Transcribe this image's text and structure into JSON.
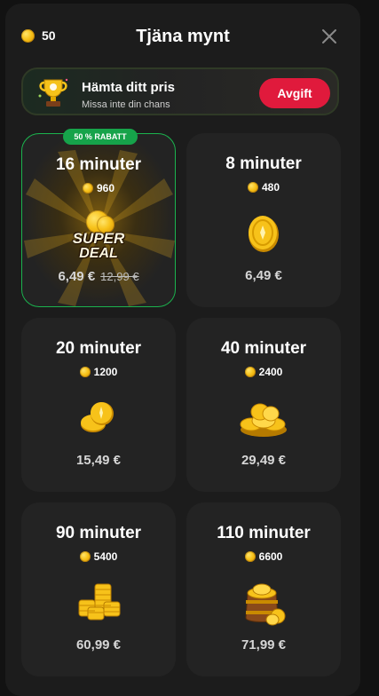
{
  "header": {
    "balance": "50",
    "title": "Tjäna mynt",
    "close_label": "close"
  },
  "banner": {
    "title": "Hämta ditt pris",
    "subtitle": "Missa inte din chans",
    "button_label": "Avgift",
    "icon": "trophy-icon"
  },
  "accent": {
    "green": "#16a34a",
    "red": "#e01a3c",
    "gold": "#f7c21a"
  },
  "offers": [
    {
      "minutes": "16 minuter",
      "coins": "960",
      "price": "6,49 €",
      "old_price": "12,99 €",
      "badge": "50 % RABATT",
      "art_line1": "SUPER",
      "art_line2": "DEAL",
      "icon": "super-deal-icon"
    },
    {
      "minutes": "8 minuter",
      "coins": "480",
      "price": "6,49 €",
      "icon": "single-coin-icon"
    },
    {
      "minutes": "20 minuter",
      "coins": "1200",
      "price": "15,49 €",
      "icon": "two-coins-icon"
    },
    {
      "minutes": "40 minuter",
      "coins": "2400",
      "price": "29,49 €",
      "icon": "coin-pile-icon"
    },
    {
      "minutes": "90 minuter",
      "coins": "5400",
      "price": "60,99 €",
      "icon": "coin-stacks-icon"
    },
    {
      "minutes": "110 minuter",
      "coins": "6600",
      "price": "71,99 €",
      "icon": "coin-pot-icon"
    }
  ]
}
